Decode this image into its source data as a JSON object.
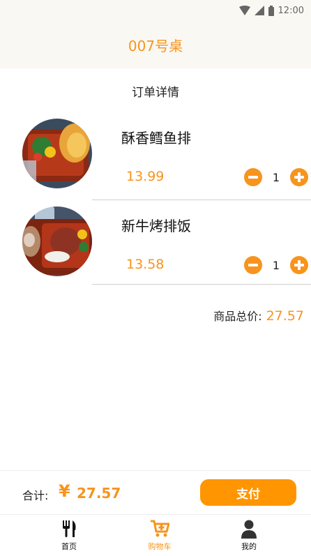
{
  "status_bar": {
    "time": "12:00"
  },
  "header": {
    "title": "007号桌"
  },
  "order": {
    "section_title": "订单详情",
    "items": [
      {
        "name": "酥香鳕鱼排",
        "price": "13.99",
        "quantity": "1"
      },
      {
        "name": "新牛烤排饭",
        "price": "13.58",
        "quantity": "1"
      }
    ],
    "total_label": "商品总价:",
    "total_value": "27.57"
  },
  "checkout": {
    "sum_label": "合计:",
    "currency": "¥",
    "sum_value": "27.57",
    "pay_label": "支付"
  },
  "tabbar": {
    "tabs": [
      {
        "label": "首页",
        "icon": "utensils-icon",
        "active": false
      },
      {
        "label": "购物车",
        "icon": "cart-icon",
        "active": true
      },
      {
        "label": "我的",
        "icon": "user-icon",
        "active": false
      }
    ]
  },
  "colors": {
    "accent": "#f7941d",
    "pay_button": "#ff9500",
    "header_bg": "#faf8f3"
  }
}
